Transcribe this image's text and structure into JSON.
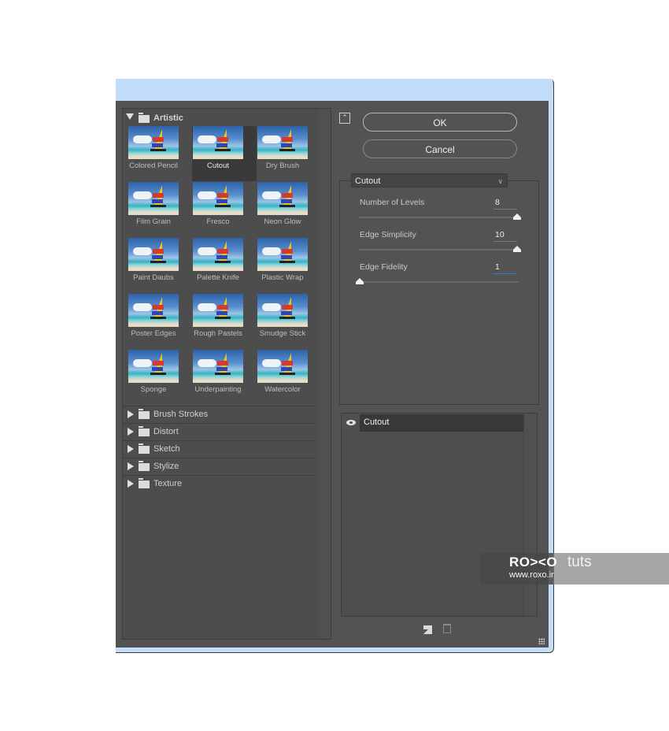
{
  "dialog": {
    "buttons": {
      "ok": "OK",
      "cancel": "Cancel",
      "collapse_icon": "double-chevron-up-icon"
    },
    "filter_gallery": {
      "expanded_category": "Artistic",
      "filters": [
        {
          "label": "Colored Pencil",
          "selected": false
        },
        {
          "label": "Cutout",
          "selected": true
        },
        {
          "label": "Dry Brush",
          "selected": false
        },
        {
          "label": "Film Grain",
          "selected": false
        },
        {
          "label": "Fresco",
          "selected": false
        },
        {
          "label": "Neon Glow",
          "selected": false
        },
        {
          "label": "Paint Daubs",
          "selected": false
        },
        {
          "label": "Palette Knife",
          "selected": false
        },
        {
          "label": "Plastic Wrap",
          "selected": false
        },
        {
          "label": "Poster Edges",
          "selected": false
        },
        {
          "label": "Rough Pastels",
          "selected": false
        },
        {
          "label": "Smudge Stick",
          "selected": false
        },
        {
          "label": "Sponge",
          "selected": false
        },
        {
          "label": "Underpainting",
          "selected": false
        },
        {
          "label": "Watercolor",
          "selected": false
        }
      ],
      "collapsed_categories": [
        "Brush Strokes",
        "Distort",
        "Sketch",
        "Stylize",
        "Texture"
      ]
    },
    "settings": {
      "filter_select": "Cutout",
      "params": [
        {
          "label": "Number of Levels",
          "value": "8",
          "slider_percent": 100
        },
        {
          "label": "Edge Simplicity",
          "value": "10",
          "slider_percent": 100
        },
        {
          "label": "Edge Fidelity",
          "value": "1",
          "slider_percent": 0
        }
      ]
    },
    "layers": [
      {
        "name": "Cutout",
        "visible": true
      }
    ],
    "layer_actions": {
      "new_icon": "new-effect-layer-icon",
      "delete_icon": "trash-icon"
    }
  },
  "watermark": {
    "brand": "RO><O",
    "suffix": "tuts",
    "url": "www.roxo.ir"
  }
}
